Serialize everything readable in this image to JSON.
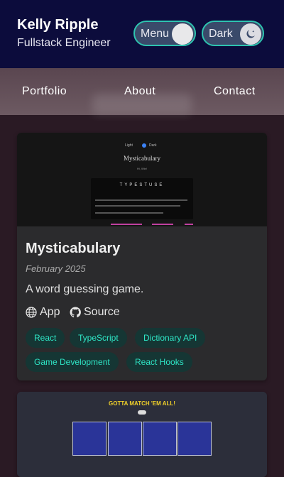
{
  "header": {
    "name": "Kelly Ripple",
    "role": "Fullstack Engineer",
    "menu_toggle_label": "Menu",
    "theme_toggle_label": "Dark"
  },
  "nav": {
    "items": [
      {
        "label": "Portfolio"
      },
      {
        "label": "About"
      },
      {
        "label": "Contact"
      }
    ]
  },
  "projects": [
    {
      "title": "Mysticabulary",
      "date": "February 2025",
      "description": "A word guessing game.",
      "app_label": "App",
      "source_label": "Source",
      "tags": [
        "React",
        "TypeScript",
        "Dictionary API",
        "Game Development",
        "React Hooks"
      ],
      "thumbnail": {
        "title": "Mysticabulary",
        "word": "TYPESTUSE",
        "toggle_left": "Light",
        "toggle_right": "Dark",
        "subtitle": "Hi, Win!"
      }
    },
    {
      "thumbnail": {
        "title": "GOTTA MATCH 'EM ALL!"
      }
    }
  ],
  "colors": {
    "header_bg": "#0c0c3c",
    "accent_teal": "#2ee6c6",
    "tag_bg": "#153634",
    "card_bg": "#2b2b2d",
    "page_bg": "#2a1a24"
  },
  "icons": {
    "moon": "moon-icon",
    "globe": "globe-icon",
    "github": "github-icon"
  }
}
